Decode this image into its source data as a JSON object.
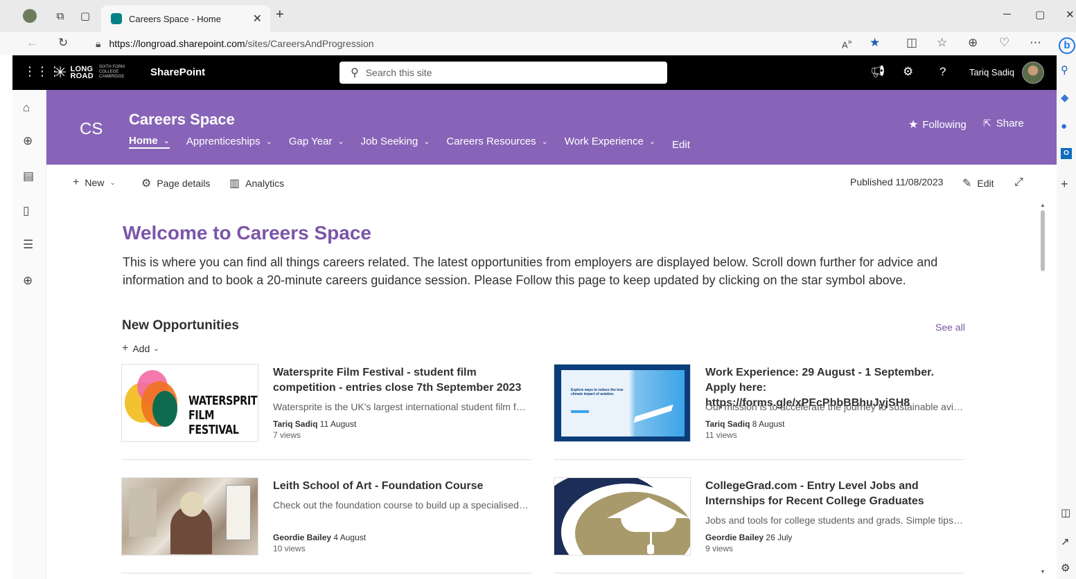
{
  "browser": {
    "tab_title": "Careers Space - Home",
    "url_host": "https://longroad.sharepoint.com",
    "url_path": "/sites/CareersAndProgression"
  },
  "suite": {
    "logo_word_1": "LONG",
    "logo_word_2": "ROAD",
    "logo_small_1": "SIXTH FORM",
    "logo_small_2": "COLLEGE",
    "logo_small_3": "CAMBRIDGE",
    "app_name": "SharePoint",
    "search_placeholder": "Search this site",
    "user_name": "Tariq Sadiq"
  },
  "site": {
    "logo_initials": "CS",
    "title": "Careers Space",
    "nav": [
      {
        "label": "Home"
      },
      {
        "label": "Apprenticeships"
      },
      {
        "label": "Gap Year"
      },
      {
        "label": "Job Seeking"
      },
      {
        "label": "Careers Resources"
      },
      {
        "label": "Work Experience"
      },
      {
        "label": "Edit"
      }
    ],
    "following_label": "Following",
    "share_label": "Share"
  },
  "commandbar": {
    "new_label": "New",
    "page_details_label": "Page details",
    "analytics_label": "Analytics",
    "published": "Published 11/08/2023",
    "edit_label": "Edit"
  },
  "page": {
    "welcome_title": "Welcome to Careers Space",
    "intro": "This is where you can find all things careers related.  The latest opportunities from employers are displayed below.  Scroll down further for advice and information and to book a 20-minute careers guidance session.  Please Follow this page to keep updated by clicking on the star symbol above."
  },
  "news": {
    "title": "New Opportunities",
    "see_all": "See all",
    "add_label": "Add",
    "items": [
      {
        "title": "Watersprite Film Festival - student film competition - entries close 7th September 2023",
        "description": "Watersprite is the UK's largest international student film festival...",
        "author": "Tariq Sadiq",
        "date": "11 August",
        "views": "7 views",
        "thumb_text_1": "WATERSPRITE",
        "thumb_text_2": "FILM FESTIVAL"
      },
      {
        "title": "Work Experience: 29 August - 1 September. Apply here: https://forms.gle/xPEcPbbBBhuJyjSH8",
        "description": "Our mission is to accelerate the journey to sustainable aviation...",
        "author": "Tariq Sadiq",
        "date": "8 August",
        "views": "11 views",
        "thumb_text_1": "Explore ways to reduce the true climate impact of aviation."
      },
      {
        "title": "Leith School of Art - Foundation Course",
        "description": "Check out the foundation course to build up a specialised portfolio...",
        "author": "Geordie Bailey",
        "date": "4 August",
        "views": "10 views"
      },
      {
        "title": "CollegeGrad.com - Entry Level Jobs and Internships for Recent College Graduates",
        "description": "Jobs and tools for college students and grads. Simple tips and advice...",
        "author": "Geordie Bailey",
        "date": "26 July",
        "views": "9 views"
      }
    ]
  },
  "colors": {
    "site_theme": "#8764b8",
    "heading_accent": "#7b55a8",
    "suite_bar": "#000000"
  }
}
